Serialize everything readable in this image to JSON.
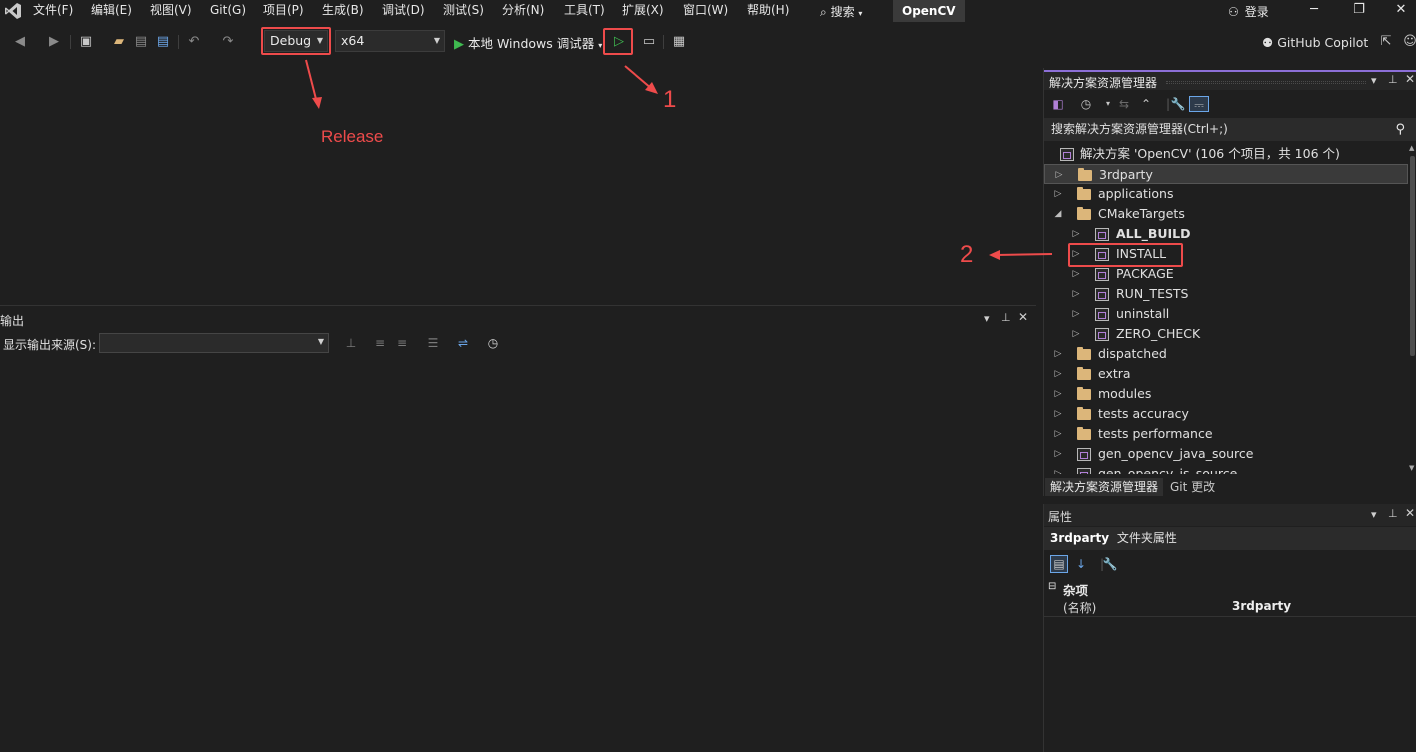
{
  "menu": {
    "items": [
      "文件(F)",
      "编辑(E)",
      "视图(V)",
      "Git(G)",
      "项目(P)",
      "生成(B)",
      "调试(D)",
      "测试(S)",
      "分析(N)",
      "工具(T)",
      "扩展(X)",
      "窗口(W)",
      "帮助(H)"
    ],
    "search_label": "搜索",
    "solution_name": "OpenCV",
    "login": "登录"
  },
  "toolbar": {
    "config": "Debug",
    "platform": "x64",
    "run_label": "本地 Windows 调试器",
    "copilot": "GitHub Copilot"
  },
  "annotations": {
    "release_note": "Release",
    "step1": "1",
    "step2": "2",
    "accent_color": "#ee4b4b"
  },
  "output": {
    "title": "输出",
    "source_label": "显示输出来源(S):"
  },
  "solution_explorer": {
    "title": "解决方案资源管理器",
    "search_placeholder": "搜索解决方案资源管理器(Ctrl+;)",
    "solution_line": "解决方案 'OpenCV' (106 个项目，共 106 个)",
    "items": [
      {
        "label": "3rdparty",
        "type": "folder",
        "level": 0,
        "expanded": false,
        "selected": true
      },
      {
        "label": "applications",
        "type": "folder",
        "level": 0,
        "expanded": false
      },
      {
        "label": "CMakeTargets",
        "type": "folder",
        "level": 0,
        "expanded": true
      },
      {
        "label": "ALL_BUILD",
        "type": "project",
        "level": 1,
        "expanded": false,
        "bold": true
      },
      {
        "label": "INSTALL",
        "type": "project",
        "level": 1,
        "expanded": false
      },
      {
        "label": "PACKAGE",
        "type": "project",
        "level": 1,
        "expanded": false
      },
      {
        "label": "RUN_TESTS",
        "type": "project",
        "level": 1,
        "expanded": false
      },
      {
        "label": "uninstall",
        "type": "project",
        "level": 1,
        "expanded": false
      },
      {
        "label": "ZERO_CHECK",
        "type": "project",
        "level": 1,
        "expanded": false
      },
      {
        "label": "dispatched",
        "type": "folder",
        "level": 0,
        "expanded": false
      },
      {
        "label": "extra",
        "type": "folder",
        "level": 0,
        "expanded": false
      },
      {
        "label": "modules",
        "type": "folder",
        "level": 0,
        "expanded": false
      },
      {
        "label": "tests accuracy",
        "type": "folder",
        "level": 0,
        "expanded": false
      },
      {
        "label": "tests performance",
        "type": "folder",
        "level": 0,
        "expanded": false
      },
      {
        "label": "gen_opencv_java_source",
        "type": "project",
        "level": 0,
        "expanded": false
      },
      {
        "label": "gen_opencv_js_source",
        "type": "project",
        "level": 0,
        "expanded": false
      }
    ],
    "tabs": [
      "解决方案资源管理器",
      "Git 更改"
    ]
  },
  "properties": {
    "title": "属性",
    "object_name": "3rdparty",
    "object_type": "文件夹属性",
    "category": "杂项",
    "row_name": "(名称)",
    "row_value": "3rdparty"
  }
}
